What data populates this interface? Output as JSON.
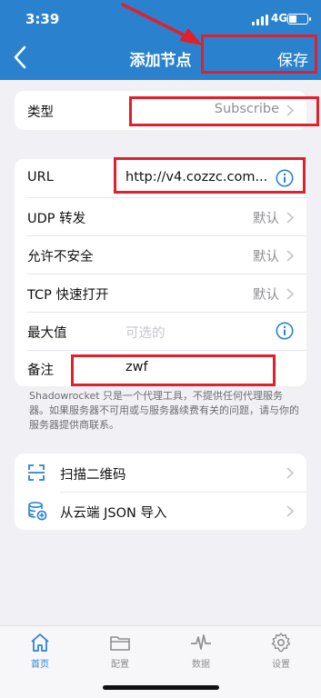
{
  "status_bar": {
    "time": "3:39",
    "network": "4G"
  },
  "nav": {
    "title": "添加节点",
    "save_label": "保存"
  },
  "type_row": {
    "label": "类型",
    "value": "Subscribe"
  },
  "form": {
    "url": {
      "label": "URL",
      "value": "http://v4.cozzc.com..."
    },
    "udp": {
      "label": "UDP 转发",
      "value": "默认"
    },
    "insecure": {
      "label": "允许不安全",
      "value": "默认"
    },
    "tcp_fast_open": {
      "label": "TCP 快速打开",
      "value": "默认"
    },
    "max_value": {
      "label": "最大值",
      "placeholder": "可选的"
    },
    "remark": {
      "label": "备注",
      "value": "zwf"
    }
  },
  "disclaimer": "Shadowrocket 只是一个代理工具，不提供任何代理服务器。如果服务器不可用或与服务器续费有关的问题，请与你的服务器提供商联系。",
  "actions": {
    "scan_qr_label": "扫描二维码",
    "import_json_label": "从云端 JSON 导入"
  },
  "tabbar": {
    "items": [
      {
        "label": "首页",
        "icon": "home-icon",
        "active": true
      },
      {
        "label": "配置",
        "icon": "folder-icon",
        "active": false
      },
      {
        "label": "数据",
        "icon": "pulse-icon",
        "active": false
      },
      {
        "label": "设置",
        "icon": "gear-icon",
        "active": false
      }
    ]
  },
  "colors": {
    "accent": "#2a82cf",
    "annotation": "#e0202a",
    "background": "#f0f0f5"
  }
}
